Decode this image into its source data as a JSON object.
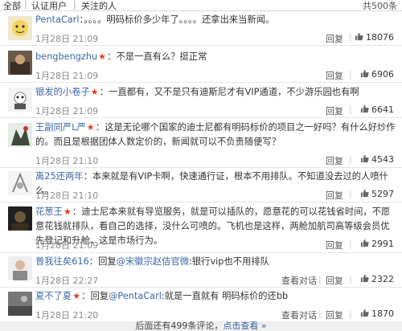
{
  "tabs": {
    "all": "全部",
    "verified": "认证用户",
    "following": "关注的人",
    "total": "共500条"
  },
  "actions": {
    "reply": "回复",
    "conversation": "查看对话"
  },
  "comments": [
    {
      "user": "PentaCarl",
      "verified": false,
      "text": "。。。。明码标价多少年了。。。。还拿出来当新闻。",
      "date": "1月28日 21:09",
      "likes": "18076"
    },
    {
      "user": "bengbengzhu",
      "verified": true,
      "text": "不是一直有么？挺正常",
      "date": "1月28日 21:09",
      "likes": "6906"
    },
    {
      "user": "银发的小卷子",
      "verified": true,
      "text": "一直都有，又不是只有迪斯尼才有VIP通道，不少游乐园也有啊",
      "date": "1月28日 21:09",
      "likes": "6641"
    },
    {
      "user": "王副同严L严",
      "verified": true,
      "text": "这是无论哪个国家的迪士尼都有明码标价的项目之一好吗？有什么好炒作的。而且是根据团体人数定价的，新闻就可以不负责随便写？",
      "date": "1月28日 21:10",
      "likes": "4543"
    },
    {
      "user": "离25还两年",
      "verified": false,
      "text": "本来就是有VIP卡啊，快速通行证，根本不用排队。不知道没去过的人喷什么。",
      "date": "1月28日 21:10",
      "likes": "5297"
    },
    {
      "user": "花葱王",
      "verified": true,
      "text": "迪士尼本来就有导览服务，就是可以插队的，愿意花的可以花钱省时间，不愿意花钱就排队，看自己的选择，没什么可喷的。飞机也是这样，两舱加航司高等级会员优先登记和升舱，这是市场行为。",
      "date": "1月28日 21:09",
      "likes": "2991"
    },
    {
      "user": "普我往矣616",
      "verified": false,
      "text_prefix": "回复",
      "mention": "@宋徽宗赵佶官微",
      "text": ":银行vip也不用排队",
      "date": "1月28日 22:27",
      "likes": "2322"
    },
    {
      "user": "夏不了夏",
      "verified": true,
      "text_prefix": "回复",
      "mention": "@PentaCarl",
      "text": ":就是一直就有 明码标价的还bb",
      "date": "1月28日 21:20",
      "likes": "1870"
    }
  ],
  "more": {
    "label": "后面还有499条评论，",
    "link": "点击查看 »"
  },
  "colors": {
    "link": "#3a67a4",
    "badge": "#e23c22",
    "date": "#8a8a8a"
  }
}
